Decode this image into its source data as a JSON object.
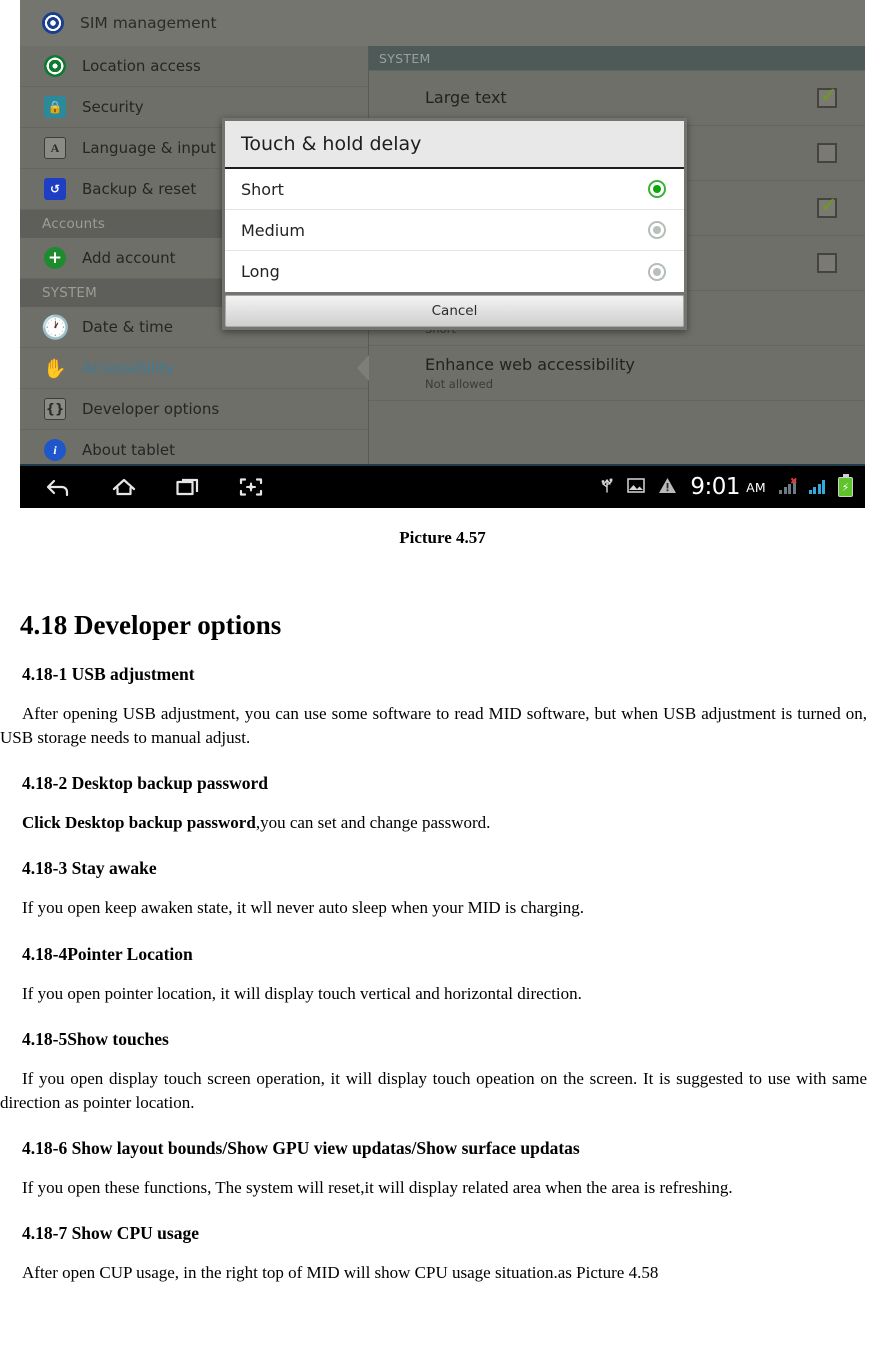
{
  "screenshot": {
    "top_row": {
      "label": "SIM management",
      "icon": "sim-card-icon"
    },
    "sidebar": [
      {
        "label": "Location access",
        "icon": "location-icon",
        "type": "item"
      },
      {
        "label": "Security",
        "icon": "lock-icon",
        "type": "item"
      },
      {
        "label": "Language & input",
        "icon": "language-icon",
        "type": "item"
      },
      {
        "label": "Backup & reset",
        "icon": "backup-icon",
        "type": "item"
      },
      {
        "label": "Accounts",
        "icon": "",
        "type": "header"
      },
      {
        "label": "Add account",
        "icon": "plus-icon",
        "type": "item"
      },
      {
        "label": "SYSTEM",
        "icon": "",
        "type": "header"
      },
      {
        "label": "Date & time",
        "icon": "clock-icon",
        "type": "item"
      },
      {
        "label": "Accessibility",
        "icon": "hand-icon",
        "type": "item",
        "selected": true
      },
      {
        "label": "Developer options",
        "icon": "braces-icon",
        "type": "item"
      },
      {
        "label": "About tablet",
        "icon": "info-icon",
        "type": "item"
      }
    ],
    "content": {
      "section_header": "SYSTEM",
      "rows": [
        {
          "title": "Large text",
          "sub": "",
          "checkbox": "checked"
        },
        {
          "title": "",
          "sub": "",
          "checkbox": "unchecked"
        },
        {
          "title": "",
          "sub": "",
          "checkbox": "checked"
        },
        {
          "title": "",
          "sub": "",
          "checkbox": "unchecked"
        },
        {
          "title": "Touch & hold delay",
          "sub": "Short",
          "checkbox": "none"
        },
        {
          "title": "Enhance web accessibility",
          "sub": "Not allowed",
          "checkbox": "none"
        }
      ]
    },
    "dialog": {
      "title": "Touch & hold delay",
      "options": [
        {
          "label": "Short",
          "selected": true
        },
        {
          "label": "Medium",
          "selected": false
        },
        {
          "label": "Long",
          "selected": false
        }
      ],
      "cancel_label": "Cancel"
    },
    "system_bar": {
      "nav": [
        {
          "name": "back-icon"
        },
        {
          "name": "home-icon"
        },
        {
          "name": "recent-apps-icon"
        },
        {
          "name": "screenshot-icon"
        }
      ],
      "status_icons": [
        {
          "name": "usb-icon"
        },
        {
          "name": "image-icon"
        },
        {
          "name": "warning-icon"
        }
      ],
      "time": "9:01",
      "meridiem": "AM",
      "signal_1": "no-service-signal-icon",
      "signal_2": "signal-bars-icon",
      "battery": "battery-charging-icon"
    },
    "colors": {
      "dim_background": "#6f6f69",
      "section_header": "#4e5a58",
      "selected_text": "#3f7b96",
      "checkbox_tick": "#6d9b1c",
      "radio_on": "#0aa60a",
      "battery_green": "#5fc32a",
      "signal_blue": "#35a8e0"
    }
  },
  "document": {
    "caption": "Picture 4.57",
    "heading": "4.18 Developer options",
    "sections": [
      {
        "heading": "4.18-1 USB adjustment",
        "body": "After opening USB adjustment, you can use some software to read MID software, but when USB adjustment is turned on, USB storage needs to manual adjust."
      },
      {
        "heading": "4.18-2 Desktop backup password",
        "body_bold": "Click Desktop backup password",
        "body_rest": ",you can set and change password."
      },
      {
        "heading": "4.18-3 Stay awake",
        "body": "If you open keep awaken state, it wll never auto sleep when your MID is charging."
      },
      {
        "heading": "4.18-4Pointer Location",
        "body": "If you open pointer location, it will display touch vertical and horizontal direction."
      },
      {
        "heading": "4.18-5Show touches",
        "body": "If you open display touch screen operation, it will display touch opeation on the screen. It is suggested to use with same direction as pointer location."
      },
      {
        "heading": "4.18-6 Show layout bounds/Show GPU view updatas/Show surface updatas",
        "body": "If you open these functions, The system will reset,it will display related area when the area is refreshing."
      },
      {
        "heading": "4.18-7 Show CPU usage",
        "body": "After open CUP usage, in the right top of MID will show CPU usage situation.as Picture 4.58"
      }
    ]
  }
}
